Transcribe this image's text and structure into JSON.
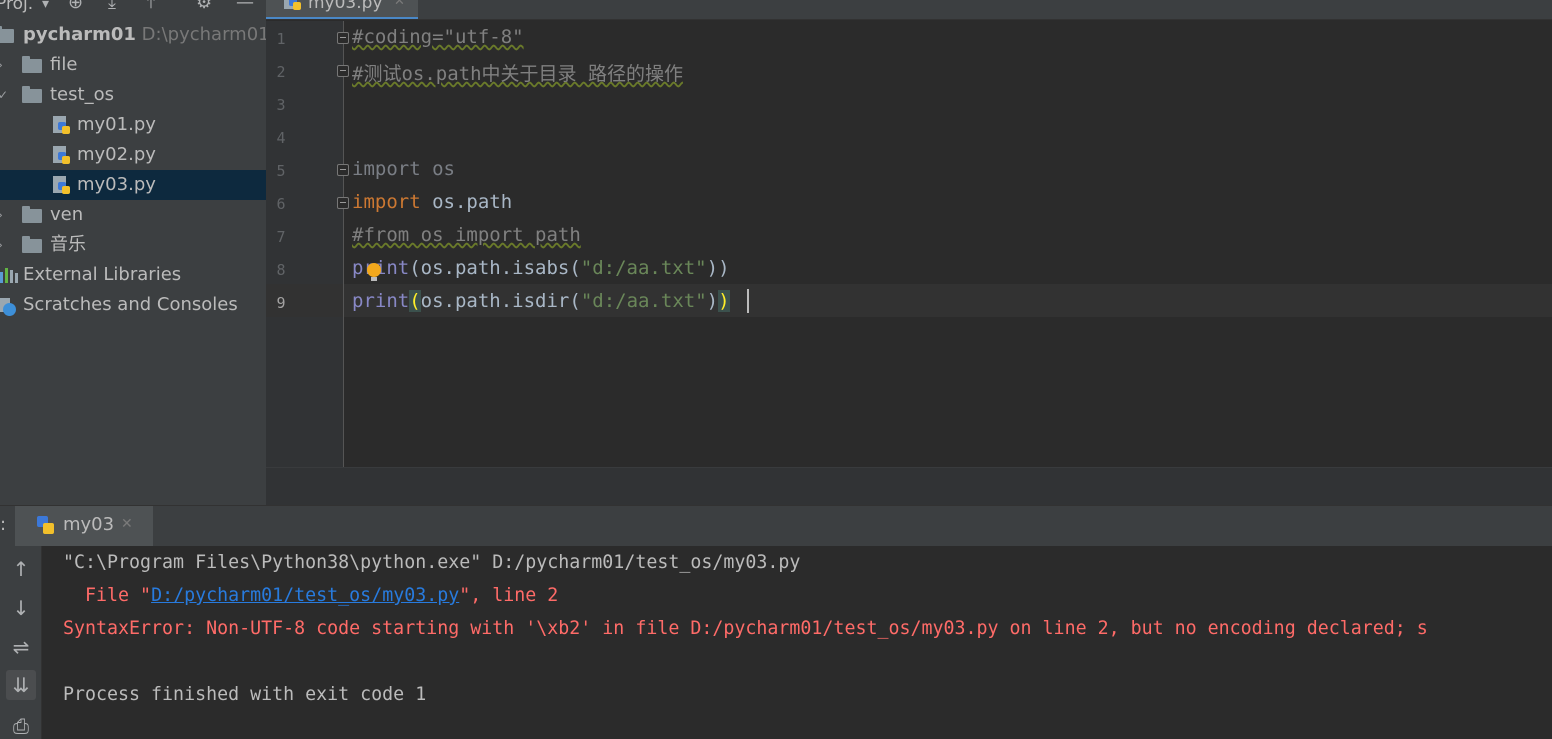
{
  "sidebar": {
    "title": "Proj.",
    "root": {
      "name": "pycharm01",
      "path": "D:\\pycharm01"
    },
    "items": [
      {
        "label": "file"
      },
      {
        "label": "test_os"
      },
      {
        "label": "my01.py"
      },
      {
        "label": "my02.py"
      },
      {
        "label": "my03.py"
      },
      {
        "label": "ven"
      },
      {
        "label": "音乐"
      },
      {
        "label": "External Libraries"
      },
      {
        "label": "Scratches and Consoles"
      }
    ]
  },
  "editor": {
    "tab_label": "my03.py",
    "line_numbers": [
      "1",
      "2",
      "3",
      "4",
      "5",
      "6",
      "7",
      "8",
      "9"
    ],
    "lines": {
      "l1": "#coding=\"utf-8\"",
      "l2": "#测试os.path中关于目录 路径的操作",
      "l5_kw": "import",
      "l5_rest": " os",
      "l6_kw": "import",
      "l6_rest": " os.path",
      "l7": "#from os import path",
      "l8_fn": "print",
      "l8_a": "(os.path.isabs(",
      "l8_str": "\"d:/aa.txt\"",
      "l8_b": "))",
      "l9_fn": "print",
      "l9_open": "(",
      "l9_a": "os.path.isdir(",
      "l9_str": "\"d:/aa.txt\"",
      "l9_b": ")",
      "l9_close": ")"
    }
  },
  "run": {
    "colon": ":",
    "tab_label": "my03",
    "output": {
      "line1": "\"C:\\Program Files\\Python38\\python.exe\" D:/pycharm01/test_os/my03.py",
      "line2_pre": "  File \"",
      "line2_link": "D:/pycharm01/test_os/my03.py",
      "line2_post": "\", line 2",
      "line3": "SyntaxError: Non-UTF-8 code starting with '\\xb2' in file D:/pycharm01/test_os/my03.py on line 2, but no encoding declared; s",
      "line5": "Process finished with exit code 1"
    }
  },
  "colors": {
    "sidebar_bg": "#3c3f41",
    "editor_bg": "#2b2b2b",
    "selection": "#0d293e",
    "keyword": "#cc7832",
    "string": "#6a8759",
    "error": "#ff6b68",
    "link": "#287bde"
  }
}
